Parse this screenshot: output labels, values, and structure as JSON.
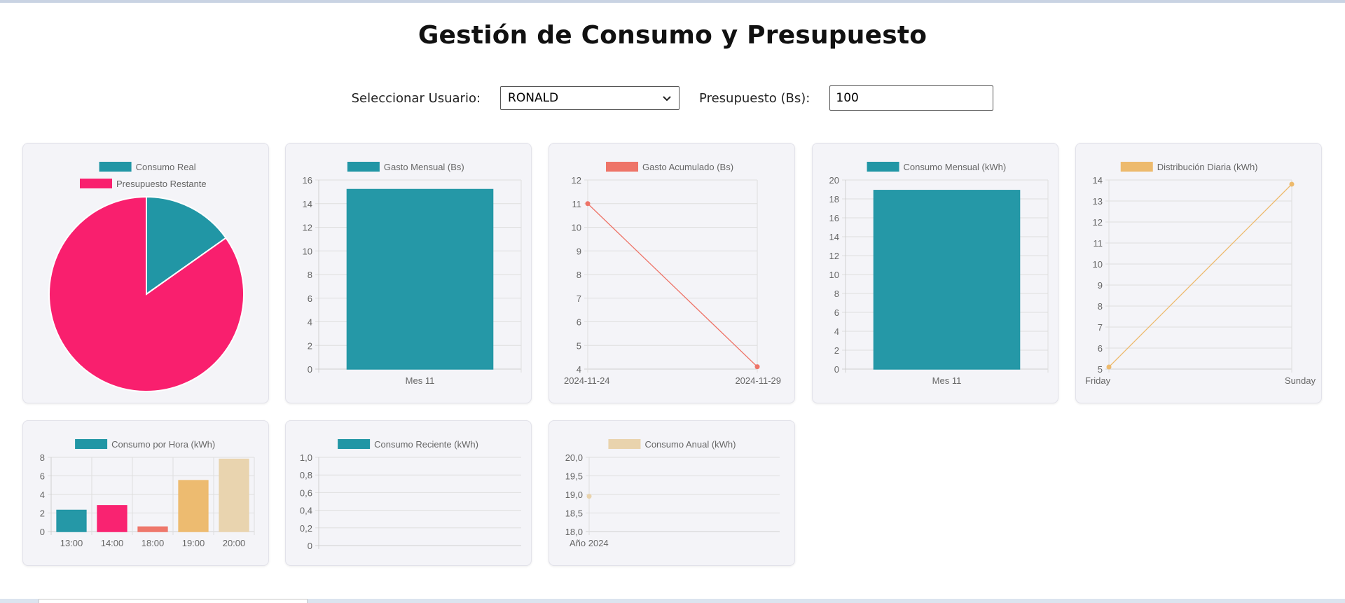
{
  "page": {
    "title": "Gestión de Consumo y Presupuesto"
  },
  "controls": {
    "user_label": "Seleccionar Usuario:",
    "user_value": "RONALD",
    "budget_label": "Presupuesto (Bs):",
    "budget_value": "100"
  },
  "colors": {
    "teal": "#2196a5",
    "pink": "#f91f6e",
    "salmon": "#ee7468",
    "orange": "#edba6d",
    "beige": "#e9d3ad"
  },
  "chart_data": [
    {
      "id": "c1",
      "type": "pie",
      "labels": [
        "Consumo Real",
        "Presupuesto Restante"
      ],
      "values": [
        15.2,
        84.8
      ],
      "colors": [
        "#2196a5",
        "#f91f6e"
      ]
    },
    {
      "id": "c2",
      "type": "bar",
      "legend": "Gasto Mensual (Bs)",
      "categories": [
        "Mes 11"
      ],
      "values": [
        15.2
      ],
      "ylim": [
        0,
        16
      ],
      "yticks": [
        "0",
        "2",
        "4",
        "6",
        "8",
        "10",
        "12",
        "14",
        "16"
      ],
      "color": "#2196a5"
    },
    {
      "id": "c3",
      "type": "line",
      "legend": "Gasto Acumulado (Bs)",
      "x": [
        "2024-11-24",
        "2024-11-29"
      ],
      "values": [
        11,
        4.1
      ],
      "ylim": [
        4,
        12
      ],
      "yticks": [
        "4",
        "5",
        "6",
        "7",
        "8",
        "9",
        "10",
        "11",
        "12"
      ],
      "color": "#ee7468"
    },
    {
      "id": "c4",
      "type": "bar",
      "legend": "Consumo Mensual (kWh)",
      "categories": [
        "Mes 11"
      ],
      "values": [
        18.9
      ],
      "ylim": [
        0,
        20
      ],
      "yticks": [
        "0",
        "2",
        "4",
        "6",
        "8",
        "10",
        "12",
        "14",
        "16",
        "18",
        "20"
      ],
      "color": "#2196a5"
    },
    {
      "id": "c5",
      "type": "line",
      "legend": "Distribución Diaria (kWh)",
      "x": [
        "Friday",
        "Sunday"
      ],
      "values": [
        5.1,
        13.8
      ],
      "ylim": [
        5,
        14
      ],
      "yticks": [
        "5",
        "6",
        "7",
        "8",
        "9",
        "10",
        "11",
        "12",
        "13",
        "14"
      ],
      "color": "#edba6d"
    },
    {
      "id": "c6",
      "type": "bar",
      "legend": "Consumo por Hora (kWh)",
      "categories": [
        "13:00",
        "14:00",
        "18:00",
        "19:00",
        "20:00"
      ],
      "values": [
        2.3,
        2.8,
        0.5,
        5.5,
        7.8
      ],
      "ylim": [
        0,
        8
      ],
      "yticks": [
        "0",
        "2",
        "4",
        "6",
        "8"
      ],
      "colors": [
        "#2196a5",
        "#f91f6e",
        "#ee7468",
        "#edba6d",
        "#e9d3ad"
      ],
      "legend_color": "#2196a5"
    },
    {
      "id": "c7",
      "type": "bar",
      "legend": "Consumo Reciente (kWh)",
      "categories": [],
      "values": [],
      "ylim": [
        0,
        1
      ],
      "yticks": [
        "0",
        "0,2",
        "0,4",
        "0,6",
        "0,8",
        "1,0"
      ],
      "color": "#2196a5"
    },
    {
      "id": "c8",
      "type": "line",
      "legend": "Consumo Anual (kWh)",
      "x": [
        "Año 2024"
      ],
      "values": [
        18.95
      ],
      "ylim": [
        18,
        20
      ],
      "yticks": [
        "18,0",
        "18,5",
        "19,0",
        "19,5",
        "20,0"
      ],
      "color": "#e9d3ad"
    }
  ]
}
